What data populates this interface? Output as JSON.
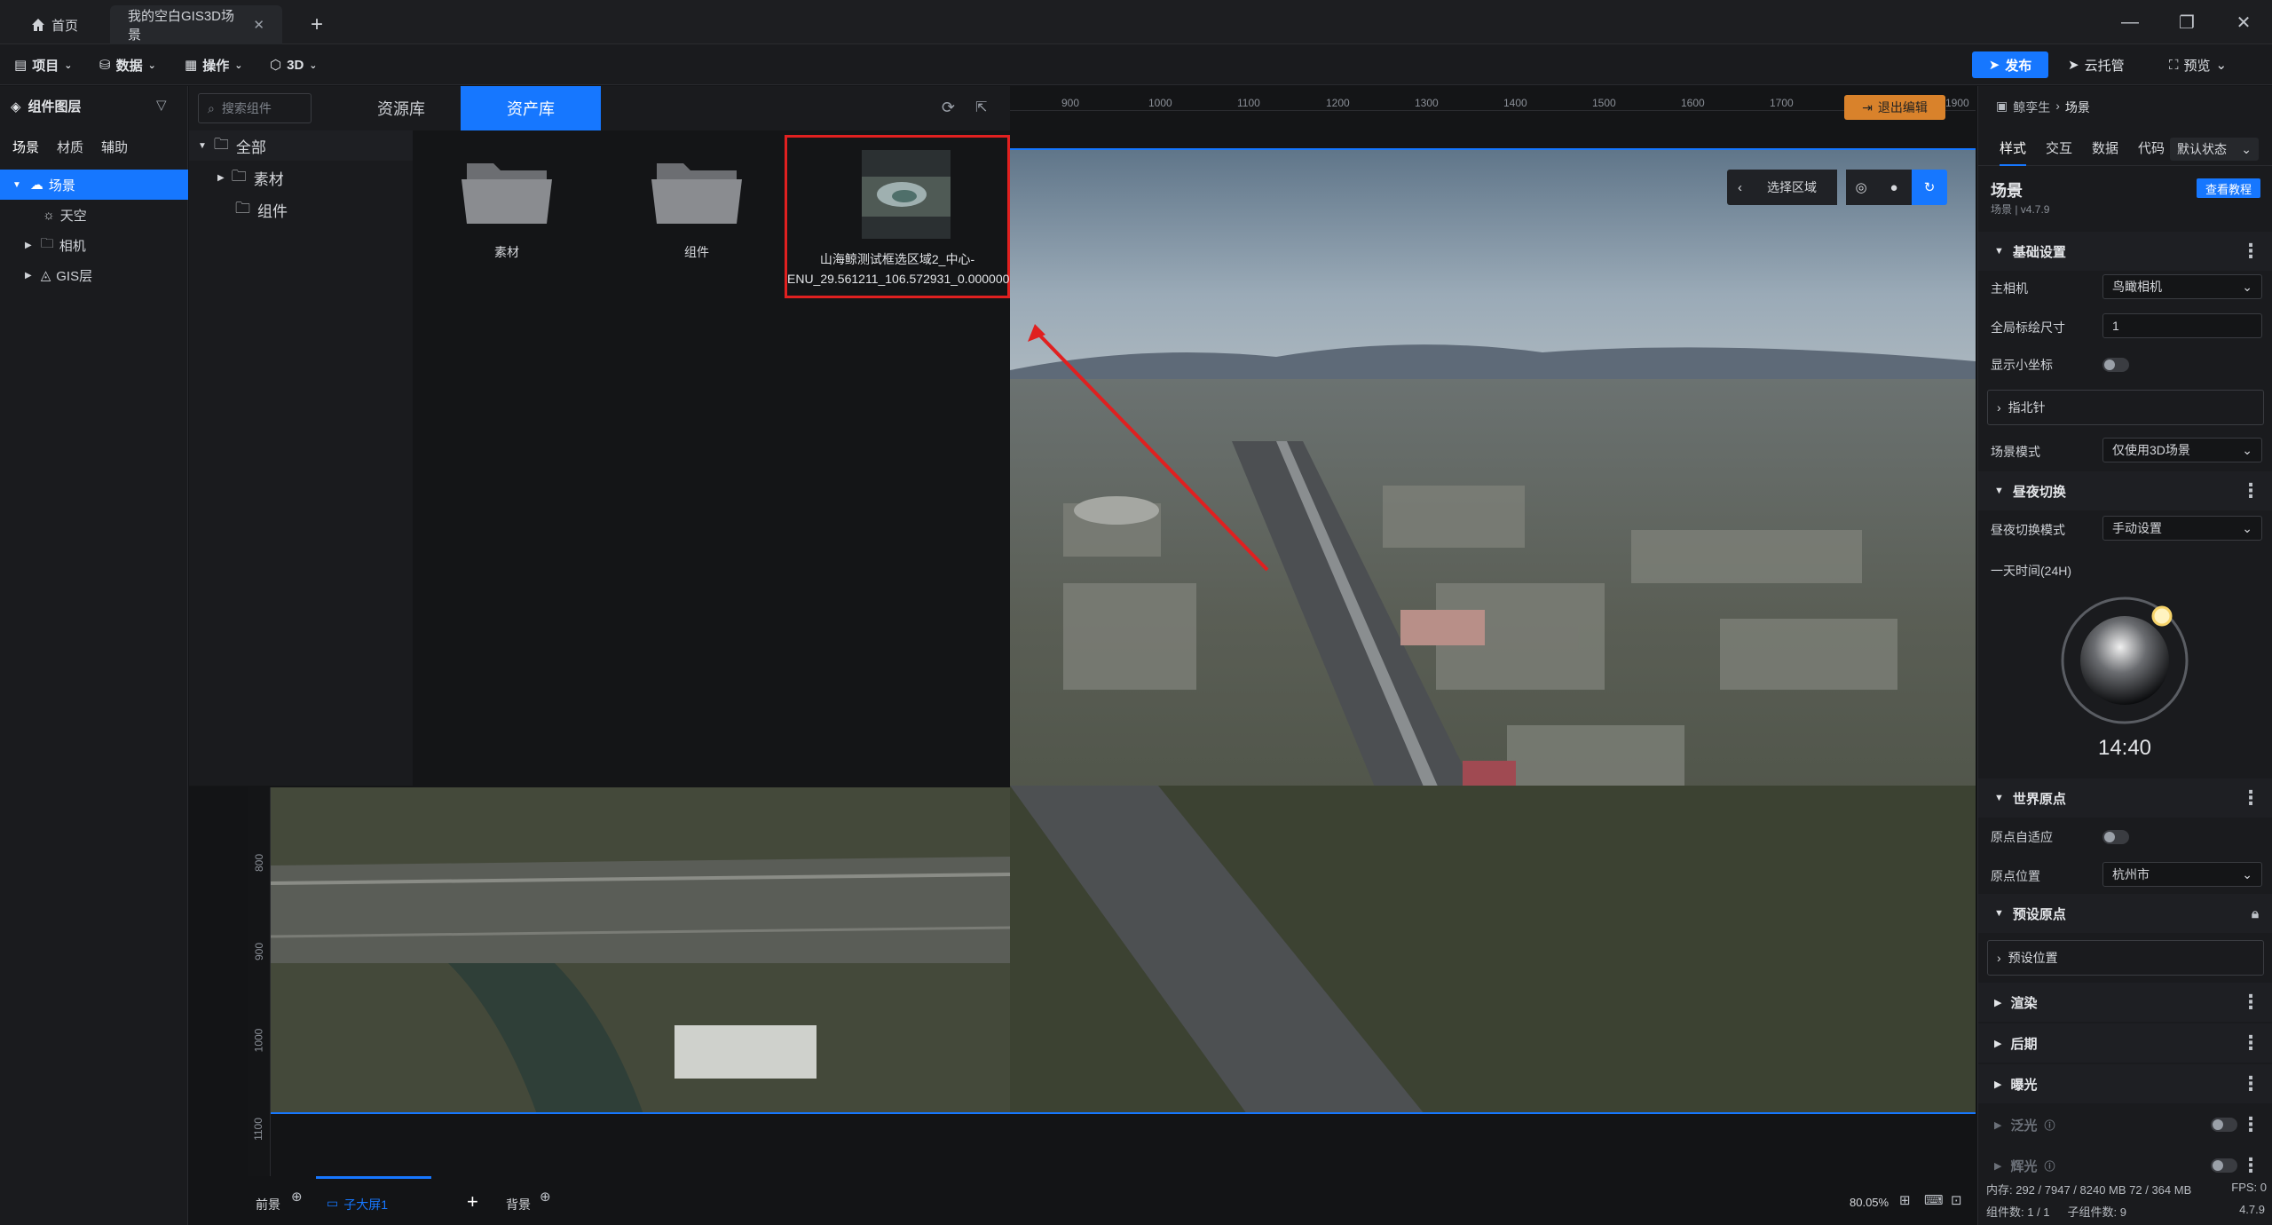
{
  "titlebar": {
    "home_tab": "首页",
    "doc_tab": "我的空白GIS3D场景",
    "add_tab": "+"
  },
  "menubar": {
    "items": [
      "项目",
      "数据",
      "操作",
      "3D"
    ],
    "publish": "发布",
    "cloud": "云托管",
    "preview": "预览"
  },
  "left_panel": {
    "title": "组件图层",
    "tabs": [
      "场景",
      "材质",
      "辅助"
    ],
    "tree": [
      {
        "label": "场景",
        "level": 0,
        "selected": true
      },
      {
        "label": "天空",
        "level": 1
      },
      {
        "label": "相机",
        "level": 1
      },
      {
        "label": "GIS层",
        "level": 1
      }
    ]
  },
  "asset_panel": {
    "search_placeholder": "搜索组件",
    "tabs": [
      "资源库",
      "资产库"
    ],
    "active_tab": "资产库",
    "tree": [
      {
        "label": "全部",
        "level": 0
      },
      {
        "label": "素材",
        "level": 1
      },
      {
        "label": "组件",
        "level": 1
      }
    ],
    "items": [
      {
        "label": "素材",
        "type": "folder"
      },
      {
        "label": "组件",
        "type": "folder"
      },
      {
        "label_line1": "山海鲸测试框选区域2_中心-",
        "label_line2": "ENU_29.561211_106.572931_0.000000",
        "type": "model",
        "highlighted": true
      }
    ]
  },
  "viewport": {
    "ruler_top": [
      "900",
      "1000",
      "1100",
      "1200",
      "1300",
      "1400",
      "1500",
      "1600",
      "1700",
      "1900"
    ],
    "ruler_left": [
      "800",
      "900",
      "1000",
      "1100"
    ],
    "exit_edit": "退出编辑",
    "select_area": "选择区域"
  },
  "right_panel": {
    "breadcrumb_root": "鲸孪生",
    "breadcrumb_current": "场景",
    "tabs": [
      "样式",
      "交互",
      "数据",
      "代码"
    ],
    "state_select": "默认状态",
    "scene_title": "场景",
    "scene_version": "场景 | v4.7.9",
    "tutorial": "查看教程",
    "basic_section": "基础设置",
    "main_camera_label": "主相机",
    "main_camera_value": "鸟瞰相机",
    "scale_label": "全局标绘尺寸",
    "scale_value": "1",
    "show_axis_label": "显示小坐标",
    "compass": "指北针",
    "scene_mode_label": "场景模式",
    "scene_mode_value": "仅使用3D场景",
    "daynight_section": "昼夜切换",
    "daynight_mode_label": "昼夜切换模式",
    "daynight_mode_value": "手动设置",
    "day_time_label": "一天时间(24H)",
    "day_time_value": "14:40",
    "world_origin_section": "世界原点",
    "origin_auto_label": "原点自适应",
    "origin_pos_label": "原点位置",
    "origin_pos_value": "杭州市",
    "preset_origin_section": "预设原点",
    "preset_pos": "预设位置",
    "render_section": "渲染",
    "post_section": "后期",
    "exposure_section": "曝光",
    "bloom_section": "泛光",
    "glow_section": "辉光"
  },
  "bottom_bar": {
    "foreground": "前景",
    "subscreen": "子大屏1",
    "background": "背景",
    "zoom": "80.05%",
    "memory": "内存: 292 / 7947 / 8240 MB  72 / 364 MB",
    "fps": "FPS: 0",
    "component_count": "组件数: 1 / 1",
    "child_count": "子组件数: 9",
    "version": "4.7.9"
  },
  "colors": {
    "accent": "#1677ff",
    "highlight_box": "#e02020",
    "exit_btn": "#d9822b"
  }
}
